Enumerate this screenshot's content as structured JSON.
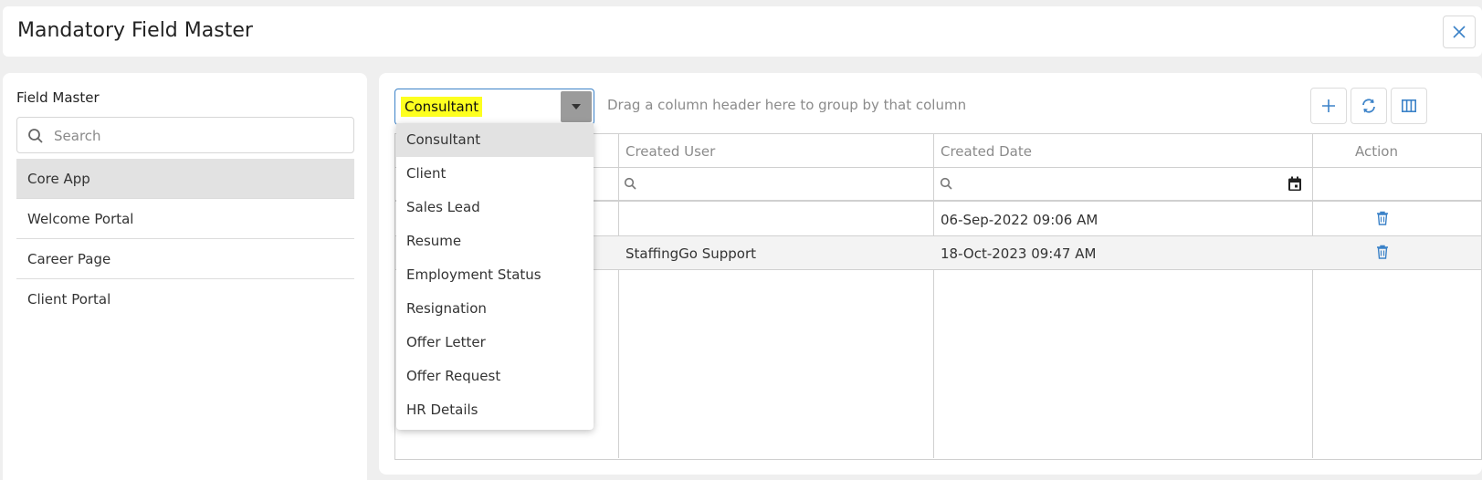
{
  "header": {
    "title": "Mandatory Field Master",
    "close_icon": "close-icon"
  },
  "sidebar": {
    "title": "Field Master",
    "search_placeholder": "Search",
    "items": [
      {
        "label": "Core App",
        "active": true
      },
      {
        "label": "Welcome Portal",
        "active": false
      },
      {
        "label": "Career Page",
        "active": false
      },
      {
        "label": "Client Portal",
        "active": false
      }
    ]
  },
  "toolbar": {
    "selected_value": "Consultant",
    "group_hint": "Drag a column header here to group by that column",
    "buttons": [
      "add-icon",
      "refresh-icon",
      "column-chooser-icon"
    ]
  },
  "dropdown": {
    "options": [
      "Consultant",
      "Client",
      "Sales Lead",
      "Resume",
      "Employment Status",
      "Resignation",
      "Offer Letter",
      "Offer Request",
      "HR Details"
    ],
    "selected_index": 0
  },
  "grid": {
    "columns": [
      "Created User",
      "Created Date",
      "Action"
    ],
    "rows": [
      {
        "created_user": "",
        "created_date": "06-Sep-2022 09:06 AM"
      },
      {
        "created_user": "StaffingGo Support",
        "created_date": "18-Oct-2023 09:47 AM"
      }
    ]
  },
  "colors": {
    "accent": "#3b82c8",
    "highlight": "#fdff1f",
    "selected_bg": "#e2e2e2"
  }
}
